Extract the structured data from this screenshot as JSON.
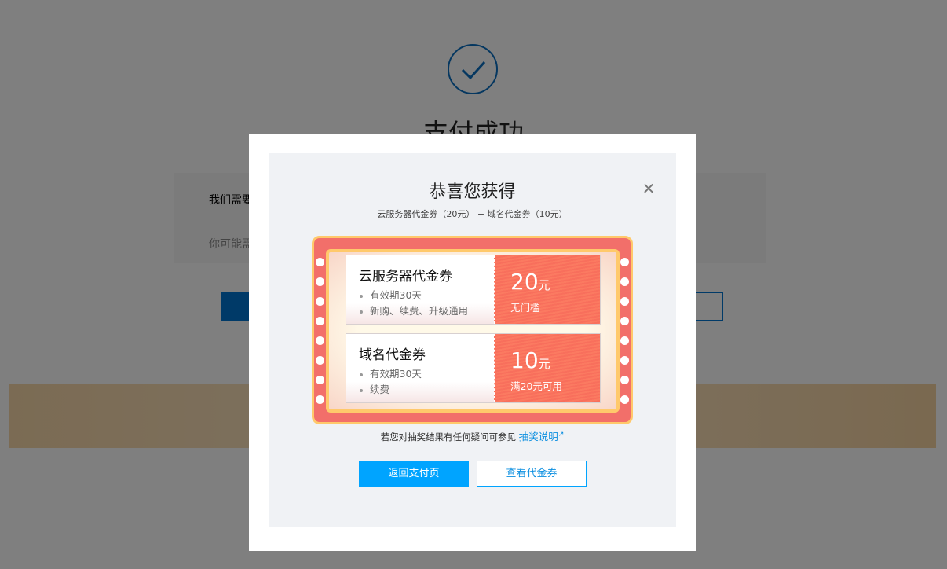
{
  "background": {
    "title": "支付成功",
    "text1": "我们需要",
    "text2": "你可能需"
  },
  "modal": {
    "title": "恭喜您获得",
    "subtitle": "云服务器代金券（20元） + 域名代金券（10元）",
    "close_icon": "close-icon",
    "coupons": [
      {
        "name": "云服务器代金券",
        "features": [
          "有效期30天",
          "新购、续费、升级通用"
        ],
        "amount": "20",
        "unit": "元",
        "condition": "无门槛"
      },
      {
        "name": "域名代金券",
        "features": [
          "有效期30天",
          "续费"
        ],
        "amount": "10",
        "unit": "元",
        "condition": "满20元可用"
      }
    ],
    "note": "若您对抽奖结果有任何疑问可参见",
    "note_link": "抽奖说明",
    "back_button": "返回支付页",
    "view_button": "查看代金券"
  },
  "colors": {
    "primary": "#00a4ff",
    "coupon_red": "#f86f5c",
    "frame_red": "#f26f6a",
    "frame_gold": "#ffc96b"
  }
}
